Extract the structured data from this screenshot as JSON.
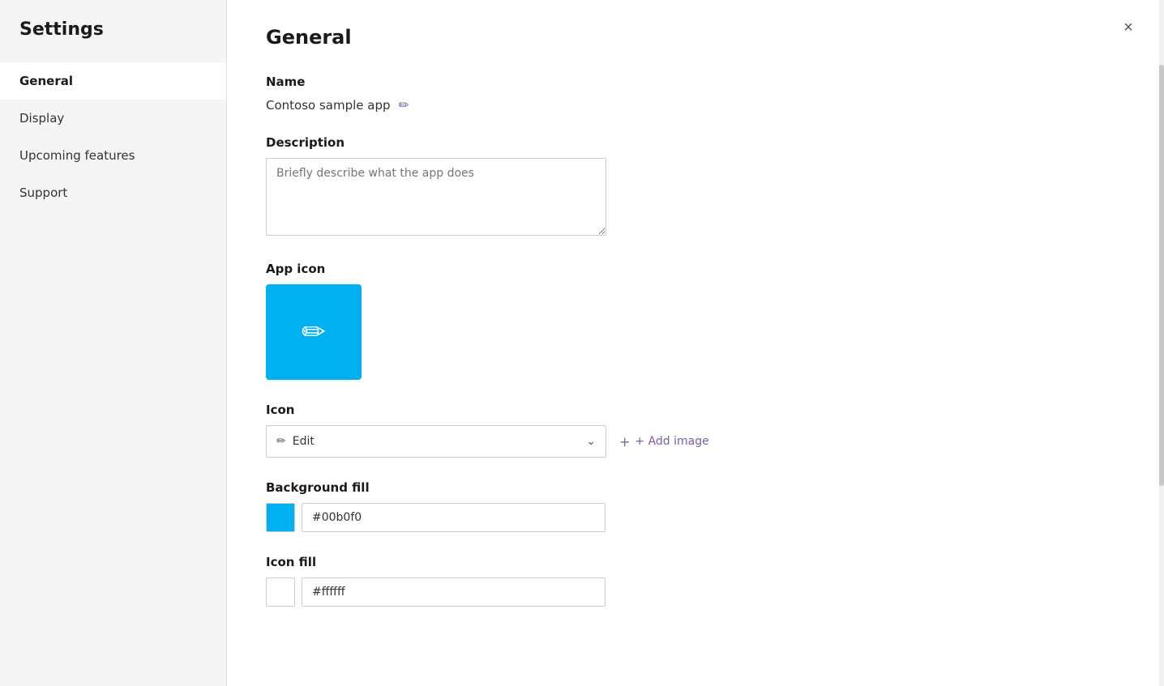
{
  "sidebar": {
    "title": "Settings",
    "items": [
      {
        "id": "general",
        "label": "General",
        "active": true
      },
      {
        "id": "display",
        "label": "Display",
        "active": false
      },
      {
        "id": "upcoming-features",
        "label": "Upcoming features",
        "active": false
      },
      {
        "id": "support",
        "label": "Support",
        "active": false
      }
    ]
  },
  "main": {
    "page_title": "General",
    "close_label": "×",
    "sections": {
      "name": {
        "label": "Name",
        "value": "Contoso sample app",
        "edit_icon": "✏"
      },
      "description": {
        "label": "Description",
        "placeholder": "Briefly describe what the app does"
      },
      "app_icon": {
        "label": "App icon"
      },
      "icon": {
        "label": "Icon",
        "selected": "Edit",
        "add_image_label": "+ Add image"
      },
      "background_fill": {
        "label": "Background fill",
        "color": "#00b0f0",
        "color_value": "#00b0f0"
      },
      "icon_fill": {
        "label": "Icon fill",
        "color": "#ffffff",
        "color_value": "#ffffff"
      }
    }
  }
}
